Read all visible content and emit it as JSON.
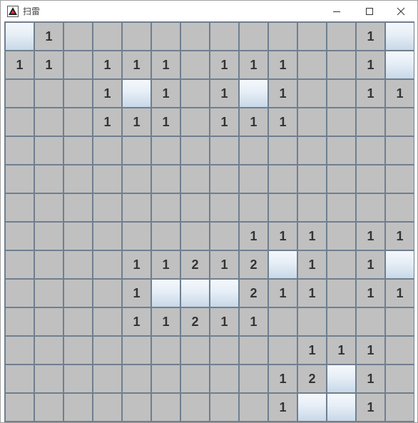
{
  "window": {
    "title": "扫雷",
    "icons": {
      "app": "minesweeper-app-icon",
      "minimize": "minimize-icon",
      "maximize": "maximize-icon",
      "close": "close-icon"
    }
  },
  "board": {
    "rows": 14,
    "cols": 14,
    "legend": {
      "C": "covered",
      "0": "revealed-empty",
      "1-8": "revealed-number"
    },
    "cells": [
      [
        "C",
        "1",
        "0",
        "0",
        "0",
        "0",
        "0",
        "0",
        "0",
        "0",
        "0",
        "0",
        "1",
        "C"
      ],
      [
        "1",
        "1",
        "0",
        "1",
        "1",
        "1",
        "0",
        "1",
        "1",
        "1",
        "0",
        "0",
        "1",
        "C"
      ],
      [
        "0",
        "0",
        "0",
        "1",
        "C",
        "1",
        "0",
        "1",
        "C",
        "1",
        "0",
        "0",
        "1",
        "1"
      ],
      [
        "0",
        "0",
        "0",
        "1",
        "1",
        "1",
        "0",
        "1",
        "1",
        "1",
        "0",
        "0",
        "0",
        "0"
      ],
      [
        "0",
        "0",
        "0",
        "0",
        "0",
        "0",
        "0",
        "0",
        "0",
        "0",
        "0",
        "0",
        "0",
        "0"
      ],
      [
        "0",
        "0",
        "0",
        "0",
        "0",
        "0",
        "0",
        "0",
        "0",
        "0",
        "0",
        "0",
        "0",
        "0"
      ],
      [
        "0",
        "0",
        "0",
        "0",
        "0",
        "0",
        "0",
        "0",
        "0",
        "0",
        "0",
        "0",
        "0",
        "0"
      ],
      [
        "0",
        "0",
        "0",
        "0",
        "0",
        "0",
        "0",
        "0",
        "1",
        "1",
        "1",
        "0",
        "1",
        "1"
      ],
      [
        "0",
        "0",
        "0",
        "0",
        "1",
        "1",
        "2",
        "1",
        "2",
        "C",
        "1",
        "0",
        "1",
        "C"
      ],
      [
        "0",
        "0",
        "0",
        "0",
        "1",
        "C",
        "C",
        "C",
        "2",
        "1",
        "1",
        "0",
        "1",
        "1"
      ],
      [
        "0",
        "0",
        "0",
        "0",
        "1",
        "1",
        "2",
        "1",
        "1",
        "0",
        "0",
        "0",
        "0",
        "0"
      ],
      [
        "0",
        "0",
        "0",
        "0",
        "0",
        "0",
        "0",
        "0",
        "0",
        "0",
        "1",
        "1",
        "1",
        "0"
      ],
      [
        "0",
        "0",
        "0",
        "0",
        "0",
        "0",
        "0",
        "0",
        "0",
        "1",
        "2",
        "C",
        "1",
        "0"
      ],
      [
        "0",
        "0",
        "0",
        "0",
        "0",
        "0",
        "0",
        "0",
        "0",
        "1",
        "C",
        "C",
        "1",
        "0"
      ]
    ]
  }
}
